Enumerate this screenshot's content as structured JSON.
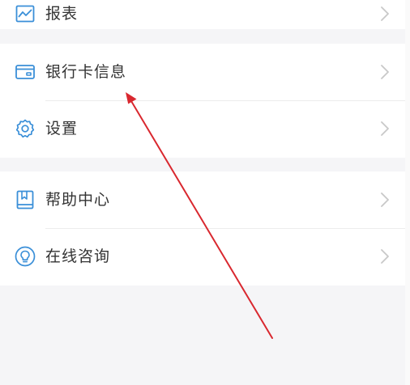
{
  "menu": {
    "report": {
      "label": "报表",
      "icon": "chart-icon"
    },
    "bank_card": {
      "label": "银行卡信息",
      "icon": "card-icon"
    },
    "settings": {
      "label": "设置",
      "icon": "gear-icon"
    },
    "help_center": {
      "label": "帮助中心",
      "icon": "book-icon"
    },
    "online_consult": {
      "label": "在线咨询",
      "icon": "bulb-icon"
    }
  },
  "colors": {
    "icon_blue": "#3a8fd8",
    "annotation_arrow": "#d9282f",
    "chevron": "#c8c8c8"
  }
}
